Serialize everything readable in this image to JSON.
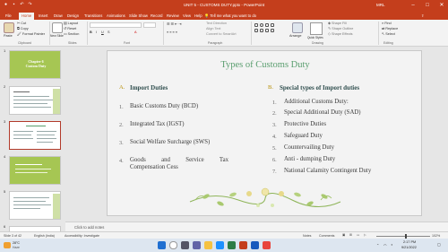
{
  "window": {
    "title": "UNIT 5 - CUSTOMS DUTY.pptx - PowerPoint",
    "user": "MRL"
  },
  "tabs": [
    "File",
    "Home",
    "Insert",
    "Draw",
    "Design",
    "Transitions",
    "Animations",
    "Slide Show",
    "Record",
    "Review",
    "View",
    "Help"
  ],
  "active_tab": "Home",
  "tell_me": "Tell me what you want to do",
  "ribbon": {
    "paste": "Paste",
    "cut": "Cut",
    "copy": "Copy",
    "format_painter": "Format Painter",
    "clipboard": "Clipboard",
    "new_slide": "New Slide",
    "reuse_slides": "Reuse Slides",
    "layout": "Layout",
    "reset": "Reset",
    "section": "Section",
    "slides": "Slides",
    "font": "Font",
    "paragraph": "Paragraph",
    "text_direction": "Text Direction",
    "align_text": "Align Text",
    "convert_smartart": "Convert to SmartArt",
    "drawing": "Drawing",
    "arrange": "Arrange",
    "quick_styles": "Quick Styles",
    "shape_fill": "Shape Fill",
    "shape_outline": "Shape Outline",
    "shape_effects": "Shape Effects",
    "find": "Find",
    "replace": "Replace",
    "select": "Select",
    "editing": "Editing"
  },
  "thumbnails": [
    {
      "num": "1",
      "text": "Chapter 6\nCustom Duty"
    },
    {
      "num": "2",
      "text": ""
    },
    {
      "num": "3",
      "text": ""
    },
    {
      "num": "4",
      "text": ""
    },
    {
      "num": "5",
      "text": ""
    },
    {
      "num": "6",
      "text": ""
    }
  ],
  "slide": {
    "title": "Types of Customs Duty",
    "left_heading_marker": "A.",
    "left_heading": "Import Duties",
    "left_items": [
      {
        "num": "1.",
        "text": "Basic Customs Duty (BCD)"
      },
      {
        "num": "2.",
        "text": "Integrated Tax (IGST)"
      },
      {
        "num": "3.",
        "text": "Social Welfare Surcharge (SWS)"
      },
      {
        "num": "4.",
        "text": "Goods and Service Tax",
        "text2": "Compensation Cess"
      }
    ],
    "right_heading_marker": "B.",
    "right_heading": "Special types of Import duties",
    "right_items": [
      {
        "num": "1.",
        "text": "Additional Customs Duty:"
      },
      {
        "num": "2.",
        "text": "Special Additional Duty (SAD)"
      },
      {
        "num": "3.",
        "text": "Protective Duties"
      },
      {
        "num": "4.",
        "text": "Safeguard Duty"
      },
      {
        "num": "5.",
        "text": "Countervailing Duty"
      },
      {
        "num": "6.",
        "text": "Anti - dumping Duty"
      },
      {
        "num": "7.",
        "text": "National Calamity Contingent Duty"
      }
    ]
  },
  "notes_placeholder": "Click to add notes",
  "status": {
    "slide_info": "Slide 3 of 42",
    "language": "English (India)",
    "accessibility": "Accessibility: Investigate",
    "notes": "Notes",
    "comments": "Comments",
    "zoom": "102%"
  },
  "taskbar": {
    "weather": "28°C",
    "weather_desc": "Haze",
    "time": "2:17 PM",
    "date": "9/21/2022",
    "search": "Search"
  },
  "colors": {
    "accent": "#c43e1c",
    "title_green": "#5a9e6f",
    "marker_gold": "#b58c00"
  }
}
